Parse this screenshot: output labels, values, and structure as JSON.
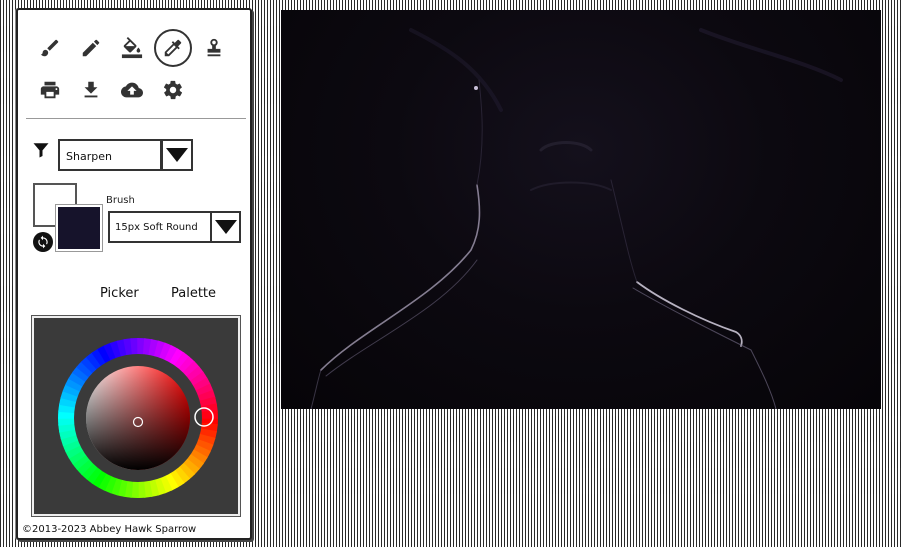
{
  "toolbar": {
    "tools": [
      {
        "name": "paintbrush-icon"
      },
      {
        "name": "pencil-icon"
      },
      {
        "name": "fill-bucket-icon"
      },
      {
        "name": "eyedropper-icon",
        "active": true
      },
      {
        "name": "stamp-icon"
      },
      {
        "name": "print-icon"
      },
      {
        "name": "download-icon"
      },
      {
        "name": "cloud-upload-icon"
      },
      {
        "name": "settings-gear-icon"
      }
    ]
  },
  "filter": {
    "selected": "Sharpen"
  },
  "colors": {
    "foreground": "#16132b",
    "background": "#ffffff",
    "picker_hue": "#ff0000"
  },
  "brush": {
    "label": "Brush",
    "selected": "15px Soft Round"
  },
  "tabs": {
    "picker": "Picker",
    "palette": "Palette"
  },
  "footer": {
    "copyright": "©2013-2023 Abbey Hawk Sparrow"
  }
}
